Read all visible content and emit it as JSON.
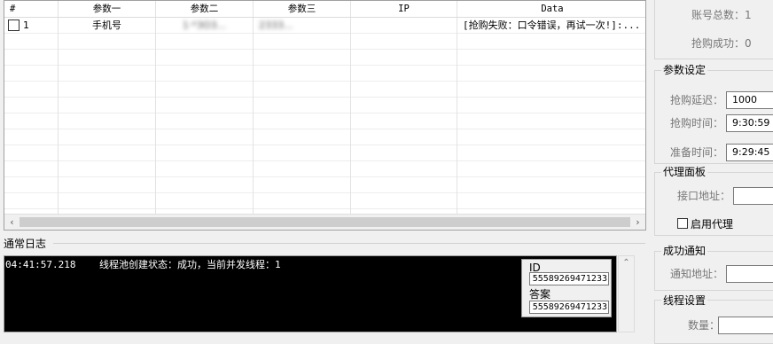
{
  "table": {
    "headers": [
      "#",
      "参数一",
      "参数二",
      "参数三",
      "IP",
      "Data"
    ],
    "rows": [
      {
        "index": "1",
        "param1": "手机号",
        "param2": "1..."
      }
    ],
    "row1": {
      "index": "1",
      "param1": "手机号",
      "param2": "1·*3O3...",
      "param3": "2333...",
      "ip": "",
      "data": "[抢购失败：口令错误，再试一次!]:..."
    }
  },
  "log": {
    "label": "通常日志",
    "lines": [
      "04:41:57.218    线程池创建状态：成功，当前并发线程：1"
    ]
  },
  "popup": {
    "id_label": "ID",
    "id_value": "55589269471233",
    "answer_label": "答案",
    "answer_value": "55589269471233"
  },
  "right": {
    "account_total_label": "账号总数：",
    "account_total_value": "1",
    "purchase_success_label": "抢购成功：",
    "purchase_success_value": "0",
    "params_group": "参数设定",
    "delay_label": "抢购延迟：",
    "delay_value": "1000",
    "buy_time_label": "抢购时间：",
    "buy_time_value": "9:30:59",
    "prep_time_label": "准备时间：",
    "prep_time_value": "9:29:45",
    "proxy_group": "代理面板",
    "api_label": "接口地址：",
    "api_value": "",
    "enable_proxy_label": "启用代理",
    "notify_group": "成功通知",
    "notify_label": "通知地址：",
    "notify_value": "",
    "thread_group": "线程设置",
    "count_label": "数量："
  }
}
